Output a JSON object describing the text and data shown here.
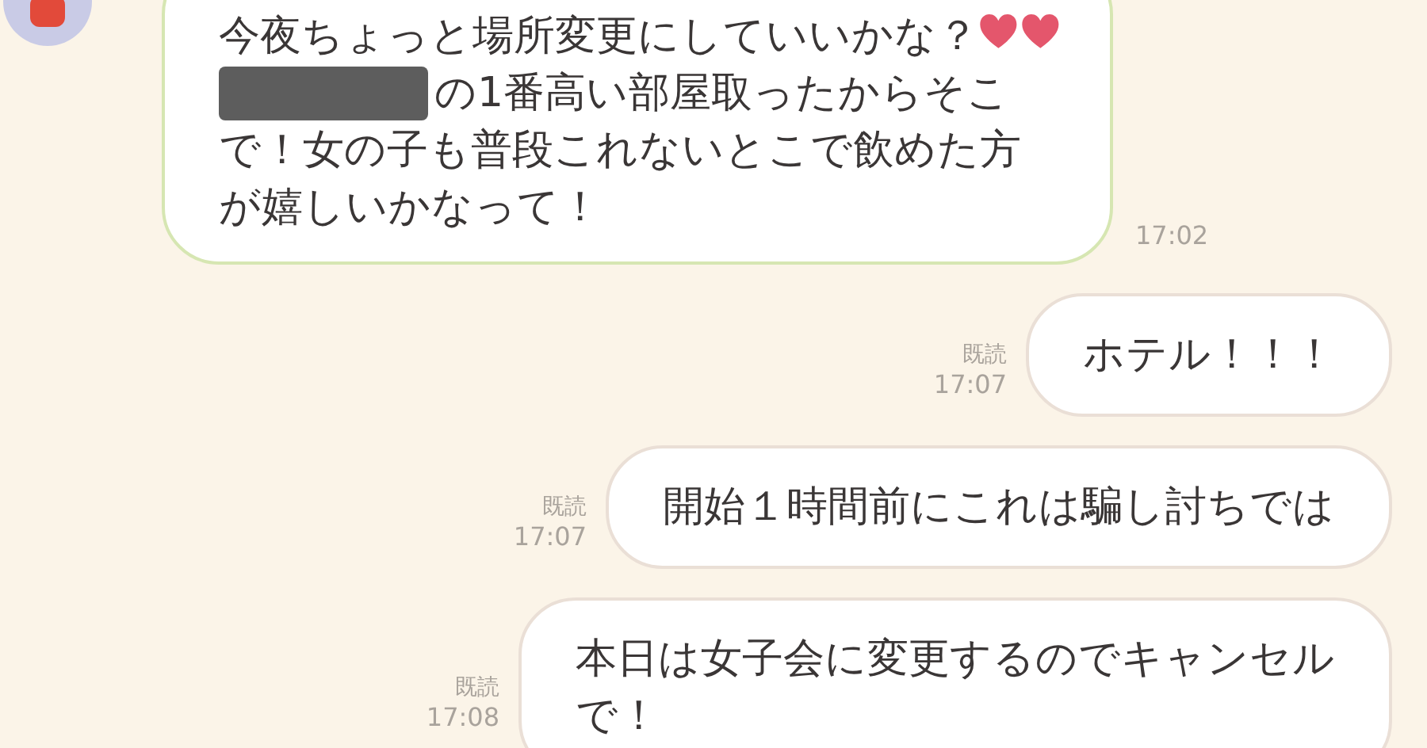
{
  "messages": [
    {
      "kind": "incoming",
      "time": "17:02",
      "lines": [
        {
          "text": "今夜ちょっと場所変更にしていいかな？",
          "hearts": true
        },
        {
          "text": "の1番高い部屋取ったからそこ",
          "redacted": true
        },
        {
          "text": "で！女の子も普段これないとこで飲めた方"
        },
        {
          "text": "が嬉しいかなって！"
        }
      ]
    },
    {
      "kind": "outgoing",
      "read": "既読",
      "time": "17:07",
      "lines": [
        {
          "text": "ホテル！！！"
        }
      ]
    },
    {
      "kind": "outgoing",
      "read": "既読",
      "time": "17:07",
      "lines": [
        {
          "text": "開始１時間前にこれは騙し討ちでは"
        }
      ]
    },
    {
      "kind": "outgoing",
      "read": "既読",
      "time": "17:08",
      "lines": [
        {
          "text": "本日は女子会に変更するのでキャンセル"
        },
        {
          "text": "で！"
        }
      ]
    }
  ]
}
